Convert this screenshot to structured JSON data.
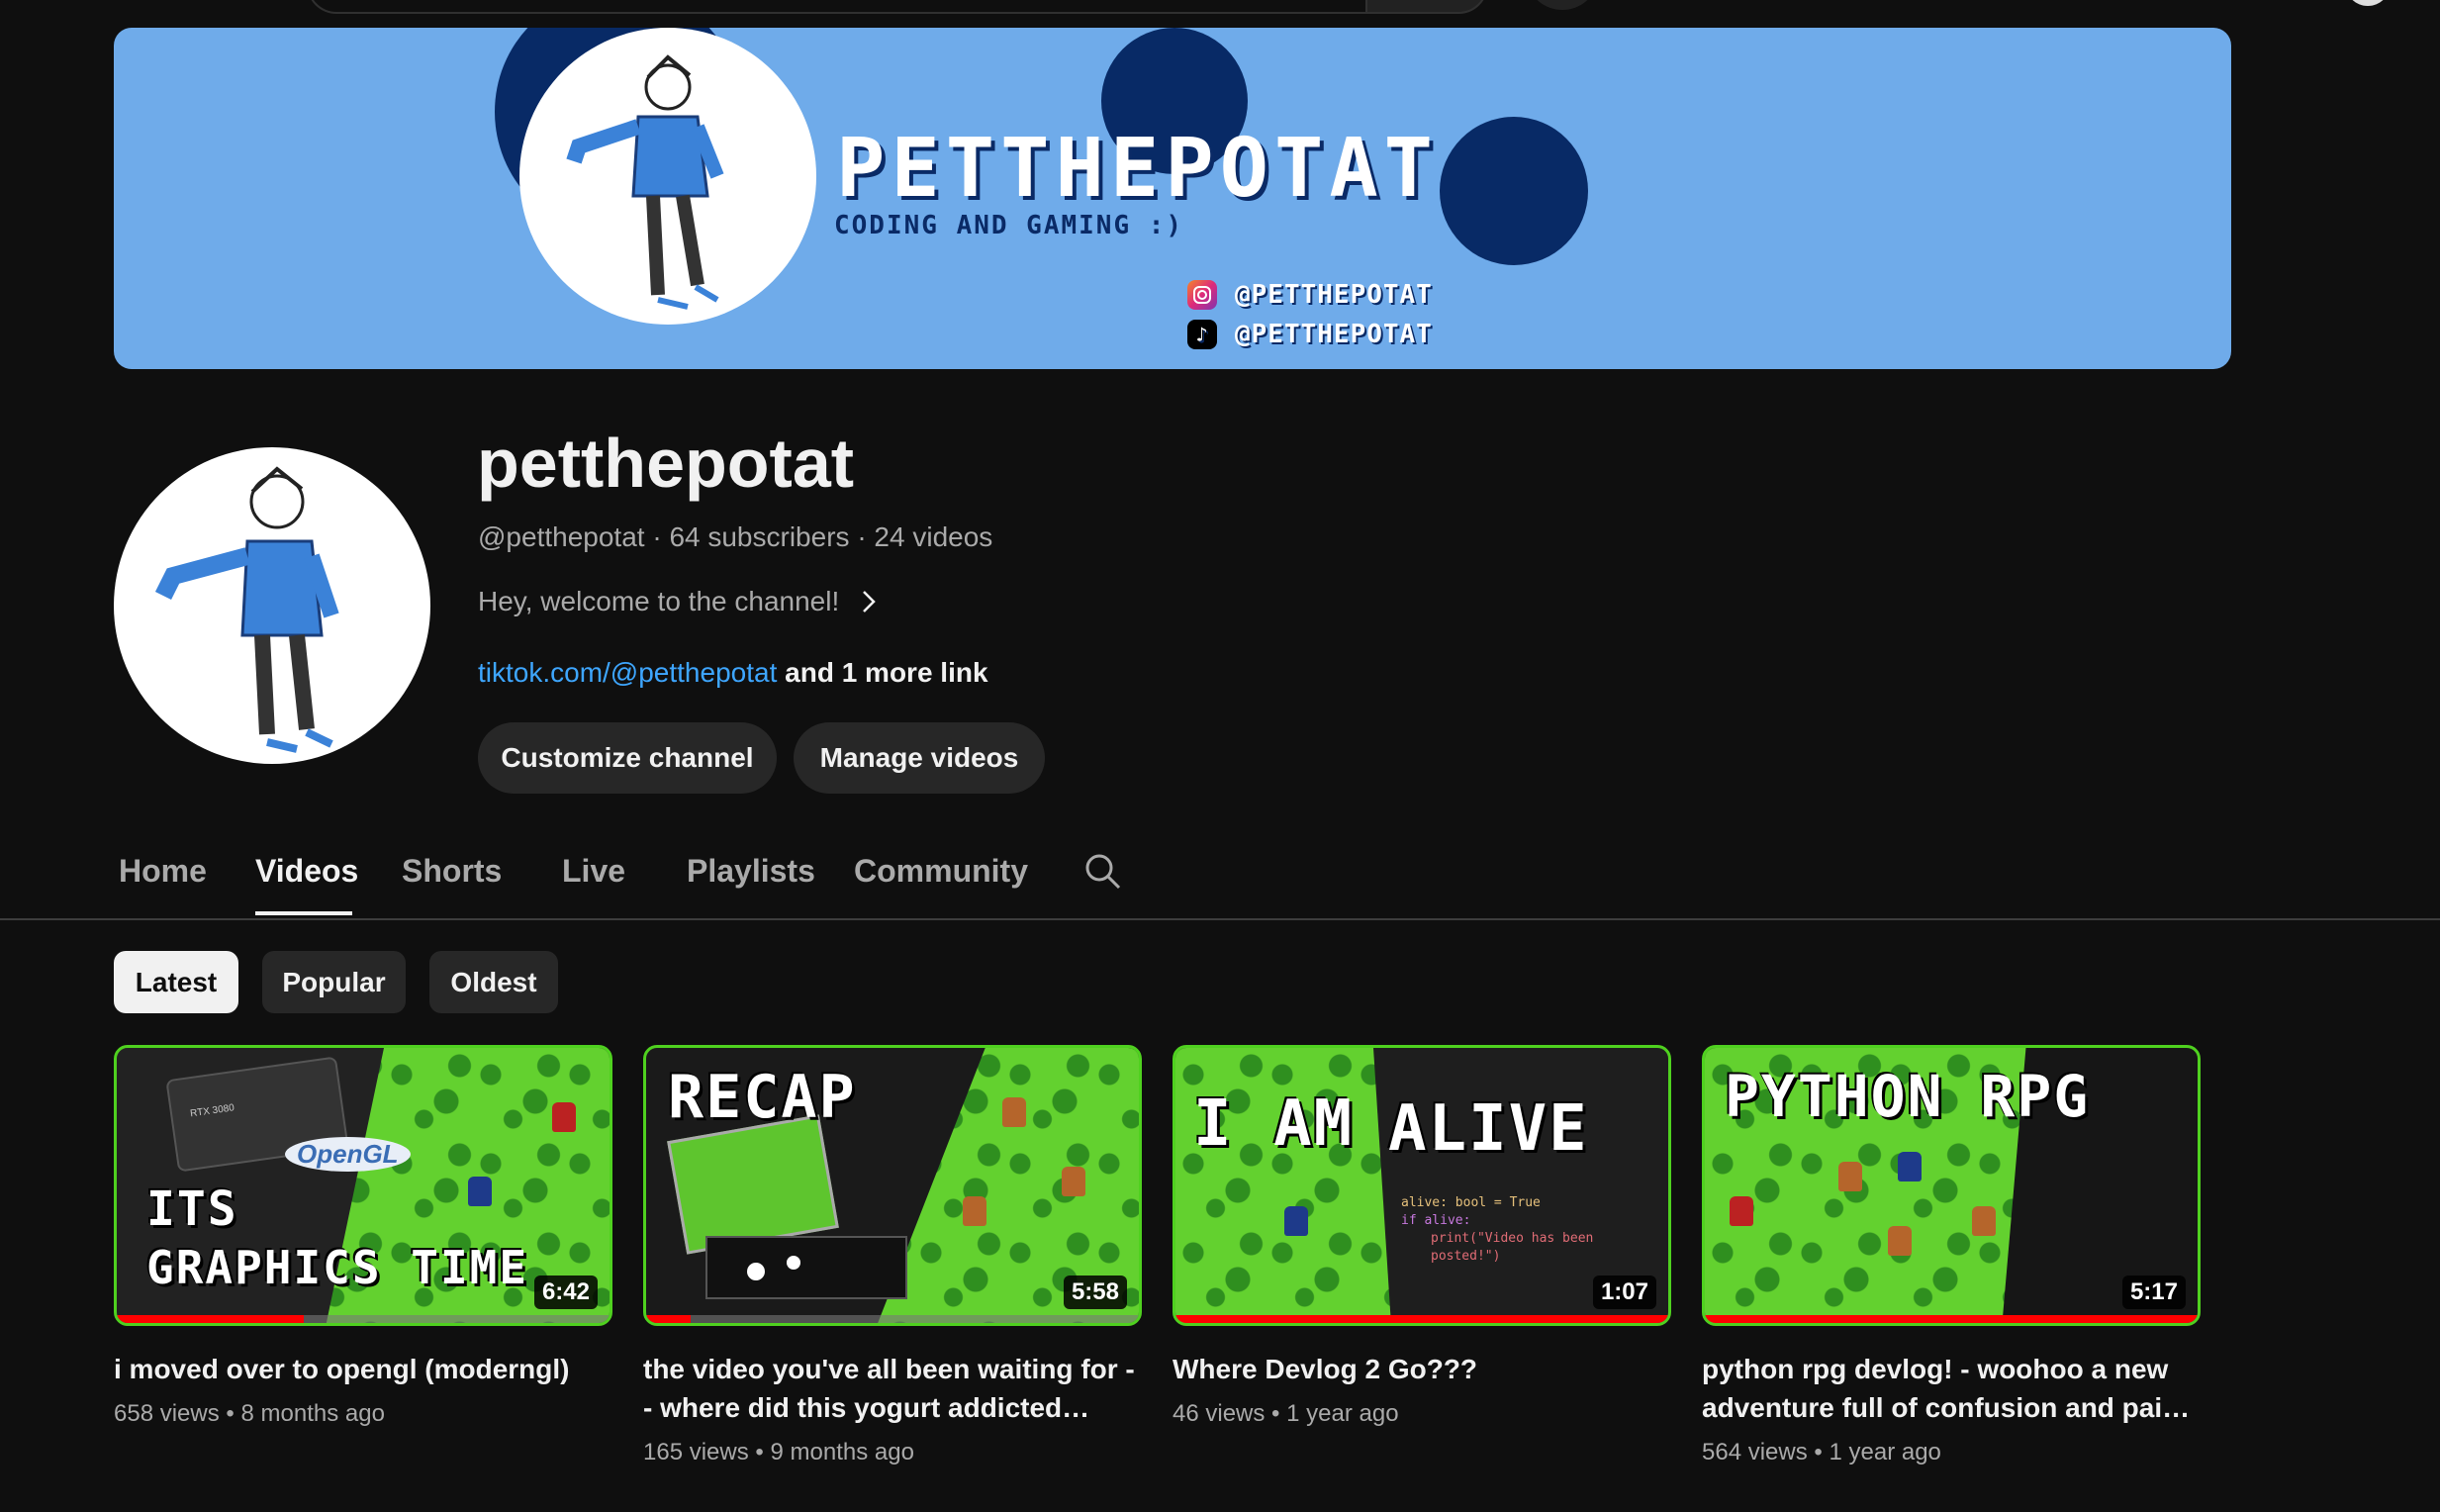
{
  "banner": {
    "title": "PETTHEPOTAT",
    "subtitle": "CODING AND GAMING :)",
    "social_instagram": "@PETTHEPOTAT",
    "social_tiktok": "@PETTHEPOTAT",
    "colors": {
      "background": "#6fabea",
      "accent": "#082a66"
    }
  },
  "channel": {
    "name": "petthepotat",
    "handle": "@petthepotat",
    "subscribers": "64 subscribers",
    "video_count": "24 videos",
    "separator": "·",
    "description": "Hey, welcome to the channel!",
    "link": "tiktok.com/@petthepotat",
    "more_links": "and 1 more link"
  },
  "actions": {
    "customize": "Customize channel",
    "manage": "Manage videos"
  },
  "tabs": [
    {
      "label": "Home"
    },
    {
      "label": "Videos",
      "active": true
    },
    {
      "label": "Shorts"
    },
    {
      "label": "Live"
    },
    {
      "label": "Playlists"
    },
    {
      "label": "Community"
    }
  ],
  "filters": [
    {
      "label": "Latest",
      "active": true
    },
    {
      "label": "Popular"
    },
    {
      "label": "Oldest"
    }
  ],
  "videos": [
    {
      "title": "i moved over to opengl (moderngl)",
      "views": "658 views",
      "age": "8 months ago",
      "duration": "6:42",
      "thumb_line1": "ITS",
      "thumb_line2": "GRAPHICS TIME",
      "thumb_badge": "OpenGL",
      "thumb_gpu": "RTX 3080",
      "watched_fraction": 0.38
    },
    {
      "title": "the video you've all been waiting for -- where did this yogurt addicted…",
      "views": "165 views",
      "age": "9 months ago",
      "duration": "5:58",
      "thumb_line1": "RECAP",
      "watched_fraction": 0.09
    },
    {
      "title": "Where Devlog 2 Go???",
      "views": "46 views",
      "age": "1 year ago",
      "duration": "1:07",
      "thumb_line1": "I AM",
      "thumb_line2": "ALIVE",
      "thumb_code1": "alive: bool = True",
      "thumb_code2": "if alive:",
      "thumb_code3": "print(\"Video has been posted!\")",
      "watched_fraction": 1.0
    },
    {
      "title": "python rpg devlog! - woohoo a new adventure full of confusion and pai…",
      "views": "564 views",
      "age": "1 year ago",
      "duration": "5:17",
      "thumb_line1": "PYTHON RPG",
      "watched_fraction": 1.0
    }
  ]
}
